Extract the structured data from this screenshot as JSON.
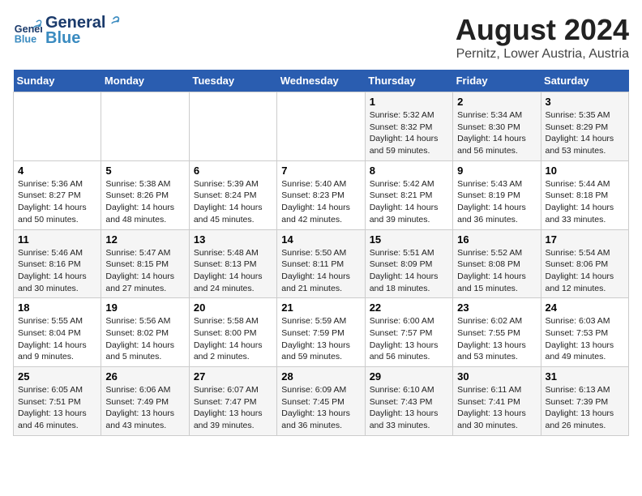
{
  "header": {
    "logo_general": "General",
    "logo_blue": "Blue",
    "title": "August 2024",
    "subtitle": "Pernitz, Lower Austria, Austria"
  },
  "days_of_week": [
    "Sunday",
    "Monday",
    "Tuesday",
    "Wednesday",
    "Thursday",
    "Friday",
    "Saturday"
  ],
  "weeks": [
    {
      "cells": [
        {
          "day": "",
          "info": ""
        },
        {
          "day": "",
          "info": ""
        },
        {
          "day": "",
          "info": ""
        },
        {
          "day": "",
          "info": ""
        },
        {
          "day": "1",
          "info": "Sunrise: 5:32 AM\nSunset: 8:32 PM\nDaylight: 14 hours\nand 59 minutes."
        },
        {
          "day": "2",
          "info": "Sunrise: 5:34 AM\nSunset: 8:30 PM\nDaylight: 14 hours\nand 56 minutes."
        },
        {
          "day": "3",
          "info": "Sunrise: 5:35 AM\nSunset: 8:29 PM\nDaylight: 14 hours\nand 53 minutes."
        }
      ]
    },
    {
      "cells": [
        {
          "day": "4",
          "info": "Sunrise: 5:36 AM\nSunset: 8:27 PM\nDaylight: 14 hours\nand 50 minutes."
        },
        {
          "day": "5",
          "info": "Sunrise: 5:38 AM\nSunset: 8:26 PM\nDaylight: 14 hours\nand 48 minutes."
        },
        {
          "day": "6",
          "info": "Sunrise: 5:39 AM\nSunset: 8:24 PM\nDaylight: 14 hours\nand 45 minutes."
        },
        {
          "day": "7",
          "info": "Sunrise: 5:40 AM\nSunset: 8:23 PM\nDaylight: 14 hours\nand 42 minutes."
        },
        {
          "day": "8",
          "info": "Sunrise: 5:42 AM\nSunset: 8:21 PM\nDaylight: 14 hours\nand 39 minutes."
        },
        {
          "day": "9",
          "info": "Sunrise: 5:43 AM\nSunset: 8:19 PM\nDaylight: 14 hours\nand 36 minutes."
        },
        {
          "day": "10",
          "info": "Sunrise: 5:44 AM\nSunset: 8:18 PM\nDaylight: 14 hours\nand 33 minutes."
        }
      ]
    },
    {
      "cells": [
        {
          "day": "11",
          "info": "Sunrise: 5:46 AM\nSunset: 8:16 PM\nDaylight: 14 hours\nand 30 minutes."
        },
        {
          "day": "12",
          "info": "Sunrise: 5:47 AM\nSunset: 8:15 PM\nDaylight: 14 hours\nand 27 minutes."
        },
        {
          "day": "13",
          "info": "Sunrise: 5:48 AM\nSunset: 8:13 PM\nDaylight: 14 hours\nand 24 minutes."
        },
        {
          "day": "14",
          "info": "Sunrise: 5:50 AM\nSunset: 8:11 PM\nDaylight: 14 hours\nand 21 minutes."
        },
        {
          "day": "15",
          "info": "Sunrise: 5:51 AM\nSunset: 8:09 PM\nDaylight: 14 hours\nand 18 minutes."
        },
        {
          "day": "16",
          "info": "Sunrise: 5:52 AM\nSunset: 8:08 PM\nDaylight: 14 hours\nand 15 minutes."
        },
        {
          "day": "17",
          "info": "Sunrise: 5:54 AM\nSunset: 8:06 PM\nDaylight: 14 hours\nand 12 minutes."
        }
      ]
    },
    {
      "cells": [
        {
          "day": "18",
          "info": "Sunrise: 5:55 AM\nSunset: 8:04 PM\nDaylight: 14 hours\nand 9 minutes."
        },
        {
          "day": "19",
          "info": "Sunrise: 5:56 AM\nSunset: 8:02 PM\nDaylight: 14 hours\nand 5 minutes."
        },
        {
          "day": "20",
          "info": "Sunrise: 5:58 AM\nSunset: 8:00 PM\nDaylight: 14 hours\nand 2 minutes."
        },
        {
          "day": "21",
          "info": "Sunrise: 5:59 AM\nSunset: 7:59 PM\nDaylight: 13 hours\nand 59 minutes."
        },
        {
          "day": "22",
          "info": "Sunrise: 6:00 AM\nSunset: 7:57 PM\nDaylight: 13 hours\nand 56 minutes."
        },
        {
          "day": "23",
          "info": "Sunrise: 6:02 AM\nSunset: 7:55 PM\nDaylight: 13 hours\nand 53 minutes."
        },
        {
          "day": "24",
          "info": "Sunrise: 6:03 AM\nSunset: 7:53 PM\nDaylight: 13 hours\nand 49 minutes."
        }
      ]
    },
    {
      "cells": [
        {
          "day": "25",
          "info": "Sunrise: 6:05 AM\nSunset: 7:51 PM\nDaylight: 13 hours\nand 46 minutes."
        },
        {
          "day": "26",
          "info": "Sunrise: 6:06 AM\nSunset: 7:49 PM\nDaylight: 13 hours\nand 43 minutes."
        },
        {
          "day": "27",
          "info": "Sunrise: 6:07 AM\nSunset: 7:47 PM\nDaylight: 13 hours\nand 39 minutes."
        },
        {
          "day": "28",
          "info": "Sunrise: 6:09 AM\nSunset: 7:45 PM\nDaylight: 13 hours\nand 36 minutes."
        },
        {
          "day": "29",
          "info": "Sunrise: 6:10 AM\nSunset: 7:43 PM\nDaylight: 13 hours\nand 33 minutes."
        },
        {
          "day": "30",
          "info": "Sunrise: 6:11 AM\nSunset: 7:41 PM\nDaylight: 13 hours\nand 30 minutes."
        },
        {
          "day": "31",
          "info": "Sunrise: 6:13 AM\nSunset: 7:39 PM\nDaylight: 13 hours\nand 26 minutes."
        }
      ]
    }
  ]
}
